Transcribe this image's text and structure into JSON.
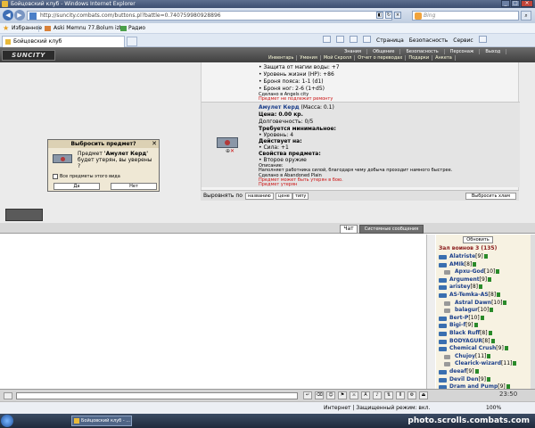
{
  "browser": {
    "title": "Бойцовский клуб - Windows Internet Explorer",
    "url": "http://suncity.combats.com/buttons.pl?battle=0.740759980928896",
    "search_placeholder": "Bing",
    "favorites_label": "Избранное",
    "fav_link1": "Aski Memnu 77.Bolum izl...",
    "fav_link2": "Радио",
    "tab_title": "Бойцовский клуб",
    "cmd_page": "Страница",
    "cmd_security": "Безопасность",
    "cmd_service": "Сервис",
    "status_text": "Интернет | Защищенный режим: вкл.",
    "zoom": "100%"
  },
  "game": {
    "logo": "SUNCITY",
    "topnav": [
      "Знания",
      "Общение",
      "Безопасность",
      "Персонаж",
      "Выход"
    ],
    "subnav": [
      "Инвентарь",
      "Умения",
      "Мой Скролл",
      "Отчет о переводах",
      "Подарки",
      "Анкета"
    ]
  },
  "item1": {
    "lines": [
      "• Защита от магии воды: +7",
      "• Уровень жизни (HP): +86",
      "• Броня пояса: 1-1 (d1)",
      "• Броня ног: 2-6 (1+d5)"
    ],
    "made_in": "Сделано в Angels city",
    "warning": "Предмет не подлежит ремонту"
  },
  "item2": {
    "name": "Амулет Керд",
    "mass": "(Масса: 0.1)",
    "price": "Цена: 0.00 кр.",
    "durability": "Долговечность: 0/5",
    "req_title": "Требуется минимальное:",
    "req_level": "• Уровень: 4",
    "effects_title": "Действует на:",
    "effect_str": "• Сила: +1",
    "props_title": "Свойства предмета:",
    "prop_weapon": "• Второе оружие",
    "desc_label": "Описание:",
    "desc": "Наполняет работника силой, благодаря чему добыча проходит намного быстрее.",
    "made_in": "Сделано в Abandoned Plain",
    "warn1": "Предмет может быть утерян в бою.",
    "warn2": "Предмет утерян"
  },
  "sort": {
    "label": "Выровнять по",
    "by_name": "названию",
    "by_price": "цене",
    "by_type": "типу",
    "throw_all": "Выбросить хлам"
  },
  "dialog": {
    "title": "Выбросить предмет?",
    "message_pre": "Предмет ",
    "item": "'Амулет Керд'",
    "message_post": " будет утерян, вы уверены ?",
    "checkbox_label": "Все предметы этого вида",
    "yes": "Да",
    "no": "Нет"
  },
  "chat": {
    "tab_chat": "Чат",
    "tab_system": "Системные сообщения",
    "clock": "23:50"
  },
  "users": {
    "refresh": "Обновить",
    "room": "Зал воинов 3 (135)",
    "list": [
      {
        "nick": "Alatriste",
        "lvl": "[9]"
      },
      {
        "nick": "AMIk",
        "lvl": "[8]"
      },
      {
        "nick": "Apxu-God",
        "lvl": "[10]",
        "indent": true
      },
      {
        "nick": "Argument",
        "lvl": "[9]"
      },
      {
        "nick": "aristey",
        "lvl": "[8]"
      },
      {
        "nick": "AS-Temka-AS",
        "lvl": "[8]"
      },
      {
        "nick": "Astral Dawn",
        "lvl": "[10]",
        "indent": true
      },
      {
        "nick": "balagur",
        "lvl": "[10]",
        "indent": true
      },
      {
        "nick": "Bert-P",
        "lvl": "[10]"
      },
      {
        "nick": "Bigi-f",
        "lvl": "[9]"
      },
      {
        "nick": "Black Ruff",
        "lvl": "[8]"
      },
      {
        "nick": "BODYAGUR",
        "lvl": "[8]"
      },
      {
        "nick": "Chemical Crush",
        "lvl": "[9]"
      },
      {
        "nick": "Chujoy",
        "lvl": "[11]",
        "indent": true
      },
      {
        "nick": "Clearick-wizard",
        "lvl": "[11]",
        "indent": true
      },
      {
        "nick": "deeaf",
        "lvl": "[9]"
      },
      {
        "nick": "Devil Den",
        "lvl": "[9]"
      },
      {
        "nick": "Dram and Pump",
        "lvl": "[9]"
      }
    ]
  },
  "taskbar": {
    "window": "Бойцовский клуб - ...",
    "watermark": "photo.scrolls.combats.com"
  }
}
